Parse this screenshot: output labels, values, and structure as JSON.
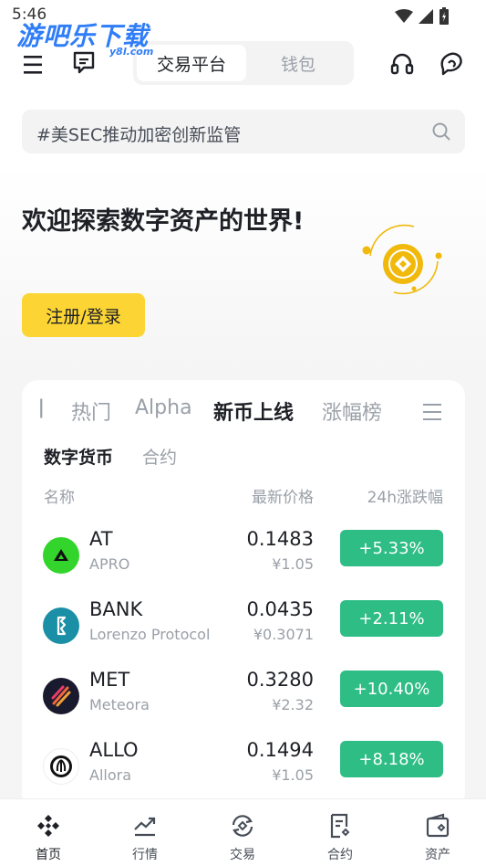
{
  "status_bar": {
    "time": "5:46"
  },
  "watermark": {
    "text": "游吧乐下载",
    "sub": "y8l.com"
  },
  "top_nav": {
    "segment_active": "交易平台",
    "segment_inactive": "钱包"
  },
  "search": {
    "placeholder": "#美SEC推动加密创新监管"
  },
  "hero": {
    "title": "欢迎探索数字资产的世界!",
    "button": "注册/登录"
  },
  "market": {
    "tabs": [
      "热门",
      "Alpha",
      "新币上线",
      "涨幅榜"
    ],
    "active_tab": "新币上线",
    "subtabs": [
      "数字货币",
      "合约"
    ],
    "active_subtab": "数字货币",
    "columns": {
      "name": "名称",
      "price": "最新价格",
      "change": "24h涨跌幅"
    },
    "rows": [
      {
        "symbol": "AT",
        "name": "APRO",
        "price": "0.1483",
        "fiat": "¥1.05",
        "change": "+5.33%",
        "logo_color": "#33d52c",
        "icon": "apro-logo-icon"
      },
      {
        "symbol": "BANK",
        "name": "Lorenzo Protocol",
        "price": "0.0435",
        "fiat": "¥0.3071",
        "change": "+2.11%",
        "logo_color": "#1b8fa6",
        "icon": "lorenzo-logo-icon"
      },
      {
        "symbol": "MET",
        "name": "Meteora",
        "price": "0.3280",
        "fiat": "¥2.32",
        "change": "+10.40%",
        "logo_color": "#1a1a2e",
        "icon": "meteora-logo-icon"
      },
      {
        "symbol": "ALLO",
        "name": "Allora",
        "price": "0.1494",
        "fiat": "¥1.05",
        "change": "+8.18%",
        "logo_color": "#ffffff",
        "icon": "allora-logo-icon"
      }
    ]
  },
  "bottom_nav": {
    "items": [
      {
        "label": "首页",
        "icon": "home-diamond-icon"
      },
      {
        "label": "行情",
        "icon": "markets-chart-icon"
      },
      {
        "label": "交易",
        "icon": "trade-swap-icon"
      },
      {
        "label": "合约",
        "icon": "futures-doc-icon"
      },
      {
        "label": "资产",
        "icon": "wallet-icon"
      }
    ]
  },
  "colors": {
    "accent_yellow": "#fcd535",
    "up_green": "#2ebd85",
    "text_primary": "#1e2026",
    "text_secondary": "#9aa0a8"
  }
}
